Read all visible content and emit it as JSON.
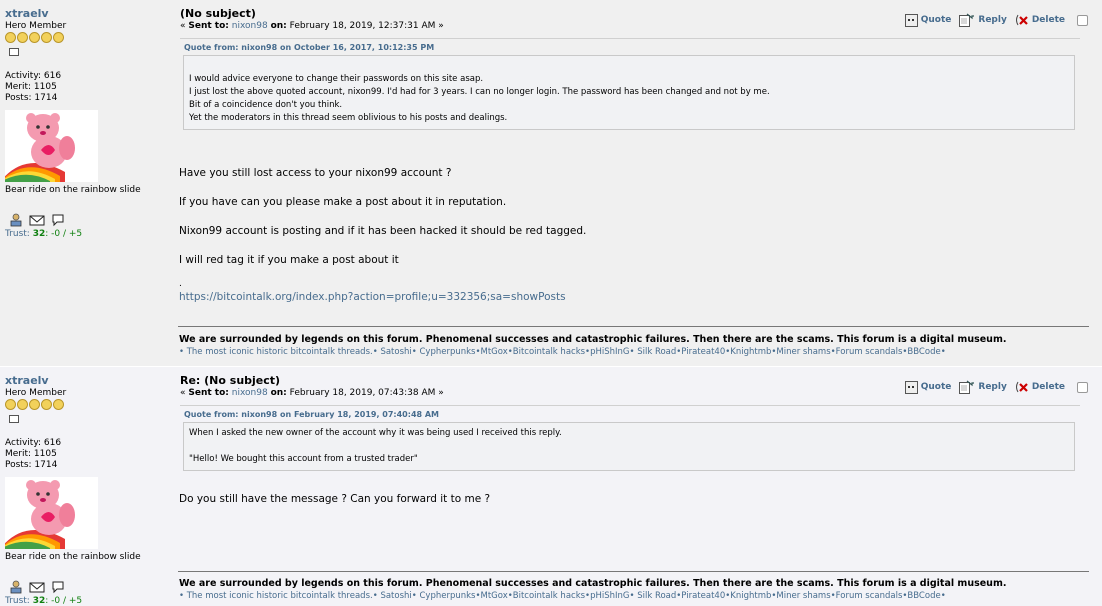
{
  "posts": [
    {
      "poster": {
        "name": "xtraelv",
        "rank": "Hero Member",
        "activity": "Activity: 616",
        "merit": "Merit: 1105",
        "posts": "Posts: 1714",
        "avatar_caption": "Bear ride on the rainbow slide",
        "trust_label": "Trust:",
        "trust_score": "32",
        "trust_detail": ": -0 / +5"
      },
      "subject": "(No subject)",
      "sent_prefix": "« ",
      "sent_label": "Sent to:",
      "sent_to": "nixon98",
      "on_label": "on:",
      "date": "February 18, 2019, 12:37:31 AM »",
      "quote_header": "Quote from: nixon98 on October 16, 2017, 10:12:35 PM",
      "quote_lines": [
        "",
        "I would advice everyone to change their passwords on this site asap.",
        "I just lost the above quoted account, nixon99. I'd had for 3 years.  I can no longer login.  The password has been changed and not by me.",
        "Bit of a coincidence don't you think.",
        "Yet the moderators in this thread seem oblivious to his posts and dealings."
      ],
      "body": [
        "Have you still lost access to your nixon99 account ?",
        "If you have can you please make a post about it in reputation.",
        "Nixon99 account is posting and if it has been hacked it should be red tagged.",
        "I will red tag it if you make a post about it"
      ],
      "dot": ".",
      "link": "https://bitcointalk.org/index.php?action=profile;u=332356;sa=showPosts"
    },
    {
      "poster": {
        "name": "xtraelv",
        "rank": "Hero Member",
        "activity": "Activity: 616",
        "merit": "Merit: 1105",
        "posts": "Posts: 1714",
        "avatar_caption": "Bear ride on the rainbow slide",
        "trust_label": "Trust:",
        "trust_score": "32",
        "trust_detail": ": -0 / +5"
      },
      "subject": "Re: (No subject)",
      "sent_prefix": "« ",
      "sent_label": "Sent to:",
      "sent_to": "nixon98",
      "on_label": "on:",
      "date": "February 18, 2019, 07:43:38 AM »",
      "quote_header": "Quote from: nixon98 on February 18, 2019, 07:40:48 AM",
      "quote_lines": [
        "When I asked the new owner of the account why it was being used I received this reply.",
        "",
        "\"Hello! We bought this account from a trusted trader\""
      ],
      "body": [
        "Do you still have the message ? Can you forward it to me ?"
      ]
    }
  ],
  "actions": {
    "quote": "Quote",
    "reply": "Reply",
    "delete": "Delete"
  },
  "signature": {
    "headline": "We are surrounded by legends on this forum. Phenomenal successes and catastrophic failures. Then there are the scams. This forum is a digital museum.",
    "links": [
      "The most iconic historic bitcointalk threads.",
      "Satoshi",
      "Cypherpunks",
      "MtGox",
      "Bitcointalk hacks",
      "pHiShInG",
      "Silk Road",
      "Pirateat40",
      "Knightmb",
      "Miner shams",
      "Forum scandals",
      "BBCode"
    ],
    "bullet": "•"
  },
  "colors": {
    "link": "#476c8e",
    "trust_green": "#108010"
  }
}
